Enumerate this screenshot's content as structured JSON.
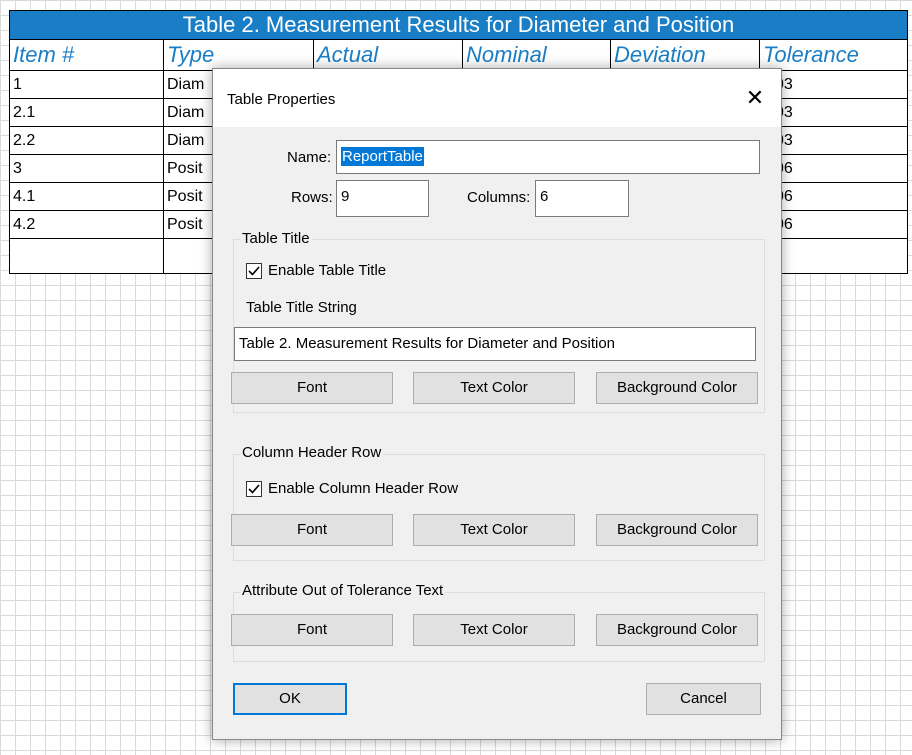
{
  "table": {
    "title": "Table 2. Measurement Results for Diameter and Position",
    "headers": [
      "Item #",
      "Type",
      "Actual",
      "Nominal",
      "Deviation",
      "Tolerance"
    ],
    "rows": [
      {
        "item": "1",
        "type": "Diam",
        "tol": "03"
      },
      {
        "item": "2.1",
        "type": "Diam",
        "tol": "03"
      },
      {
        "item": "2.2",
        "type": "Diam",
        "tol": "03"
      },
      {
        "item": "3",
        "type": "Posit",
        "tol": "06"
      },
      {
        "item": "4.1",
        "type": "Posit",
        "tol": "06"
      },
      {
        "item": "4.2",
        "type": "Posit",
        "tol": "06"
      },
      {
        "item": "",
        "type": "",
        "tol": ""
      }
    ],
    "colors": {
      "title_bg": "#1a7ec6",
      "header_text": "#1a7ec6"
    }
  },
  "dialog": {
    "title": "Table Properties",
    "close_glyph": "✕",
    "name_label": "Name:",
    "name_value": "ReportTable",
    "rows_label": "Rows:",
    "rows_value": "9",
    "columns_label": "Columns:",
    "columns_value": "6",
    "table_title_group": "Table Title",
    "enable_table_title": "Enable Table Title",
    "enable_table_title_checked": true,
    "table_title_string_label": "Table Title String",
    "table_title_string_value": "Table 2. Measurement Results for Diameter and Position",
    "column_header_group": "Column Header Row",
    "enable_column_header": "Enable Column Header Row",
    "enable_column_header_checked": true,
    "attribute_group": "Attribute Out of Tolerance Text",
    "font_button": "Font",
    "text_color_button": "Text Color",
    "background_color_button": "Background Color",
    "ok_button": "OK",
    "cancel_button": "Cancel",
    "accent_color": "#0078d7"
  }
}
